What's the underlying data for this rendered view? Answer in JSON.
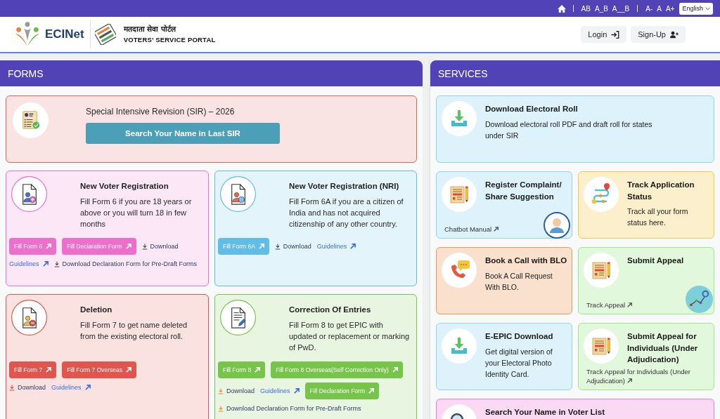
{
  "top_bar": {
    "spacing_options": [
      "AB",
      "A_B",
      "A__B"
    ],
    "size_options": [
      "A-",
      "A",
      "A+"
    ],
    "language": "English"
  },
  "header": {
    "brand": "ECINet",
    "portal_title_hindi": "मतदाता सेवा पोर्टल",
    "portal_title": "VOTERS’ SERVICE PORTAL",
    "buttons": [
      "Login",
      "Sign-Up"
    ]
  },
  "forms": {
    "title": "FORMS",
    "cards": [
      {
        "kind": "banner",
        "color": "#e0605a",
        "title": "Special Intensive Revision (SIR) – 2026",
        "button": "Search Your Name in Last SIR"
      },
      {
        "kind": "form",
        "color": "#ec6fcb",
        "title": "New Voter Registration",
        "description": "Fill Form 6 if you are 18 years or above or you will turn 18 in few months",
        "action_rows": [
          [
            {
              "kind": "button",
              "label": "Fill Form 6"
            },
            {
              "kind": "button",
              "label": "Fill Declaration Form"
            },
            {
              "kind": "download",
              "label": "Download"
            }
          ],
          [
            {
              "kind": "link",
              "label": "Guidelines"
            },
            {
              "kind": "download",
              "label": "Download Declaration Form for Pre-Draft Forms"
            }
          ]
        ]
      },
      {
        "kind": "form",
        "color": "#62bde6",
        "title": "New Voter Registration (NRI)",
        "description": "Fill Form 6A if you are a citizen of India and has not acquired citizenship of any other country.",
        "action_rows": [
          [
            {
              "kind": "button",
              "label": "Fill Form 6A"
            },
            {
              "kind": "download",
              "label": "Download"
            },
            {
              "kind": "link",
              "label": "Guidelines"
            }
          ]
        ]
      },
      {
        "kind": "form",
        "color": "#e0554d",
        "title": "Deletion",
        "description": "Fill Form 7 to get name deleted from the existing electoral roll.",
        "action_rows": [
          [
            {
              "kind": "button",
              "label": "Fill Form 7"
            },
            {
              "kind": "button",
              "label": "Fill Form 7 Overseas"
            }
          ],
          [
            {
              "kind": "download",
              "label": "Download"
            },
            {
              "kind": "link",
              "label": "Guidelines"
            }
          ]
        ]
      },
      {
        "kind": "form",
        "color": "#76c44a",
        "title": "Correction Of Entries",
        "description": "Fill Form 8 to get EPIC with updated or replacement or marking of PwD.",
        "action_rows": [
          [
            {
              "kind": "button",
              "label": "Fill Form 8"
            },
            {
              "kind": "button",
              "label": "Fill Form 8 Overseas(Self Correction Only)"
            }
          ],
          [
            {
              "kind": "download",
              "label": "Download"
            },
            {
              "kind": "link",
              "label": "Guidelines"
            },
            {
              "kind": "button",
              "label": "Fill Declaration Form"
            }
          ],
          [
            {
              "kind": "download",
              "label": "Download Declaration Form for Pre-Draft Forms"
            }
          ]
        ]
      }
    ]
  },
  "services": {
    "title": "SERVICES",
    "cards": [
      {
        "kind": "wide",
        "color": "#8fd3f0",
        "title": "Download Electoral Roll",
        "description": "Download electoral roll PDF and draft roll for states under SIR"
      },
      {
        "kind": "half",
        "color": "#8fd3f0",
        "title": "Register Complaint/ Share Suggestion",
        "link": "Chatbot Manual"
      },
      {
        "kind": "half",
        "color": "#f5c850",
        "title": "Track Application Status",
        "description": "Track all your form status here."
      },
      {
        "kind": "half",
        "color": "#ec9a5c",
        "title": "Book a Call with BLO",
        "description": "Book A Call Request With BLO."
      },
      {
        "kind": "half",
        "color": "#9fe88a",
        "title": "Submit Appeal",
        "link": "Track Appeal"
      },
      {
        "kind": "half",
        "color": "#8fd3f0",
        "title": "E-EPIC Download",
        "description": "Get digital version of your Electoral Photo Identity Card."
      },
      {
        "kind": "half",
        "color": "#9fe88a",
        "title": "Submit Appeal for Individuals (Under Adjudication)",
        "link": "Track Appeal for Individuals (Under Adjudication)"
      },
      {
        "kind": "wide",
        "color": "#ef7fd4",
        "title": "Search Your Name in Voter List"
      }
    ]
  }
}
